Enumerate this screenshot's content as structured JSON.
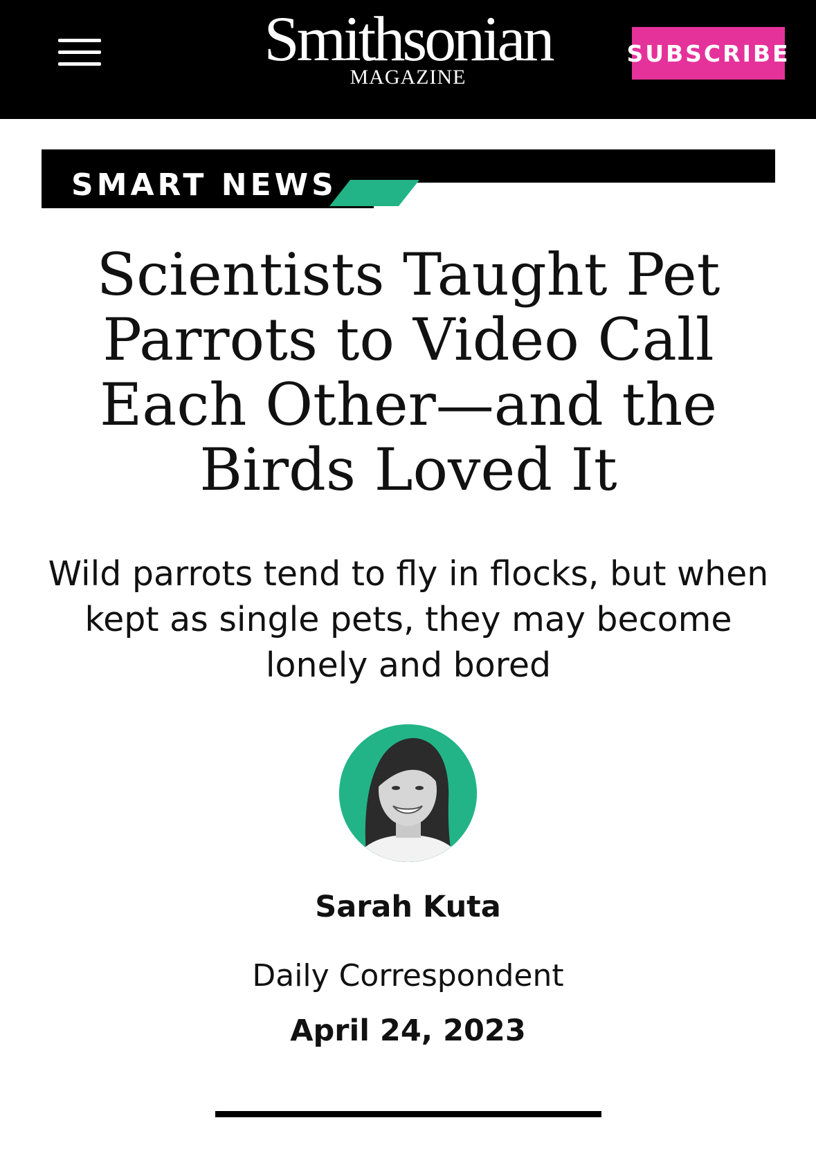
{
  "header": {
    "logo_main": "Smithsonian",
    "logo_sub": "MAGAZINE",
    "menu_icon": "hamburger-menu-icon",
    "subscribe_label": "SUBSCRIBE",
    "subscribe_color": "#e5329a",
    "background_color": "#000000"
  },
  "section": {
    "label": "SMART NEWS",
    "accent_color": "#22b486"
  },
  "article": {
    "headline": "Scientists Taught Pet Parrots to Video Call Each Other—and the Birds Loved It",
    "dek": "Wild parrots tend to fly in flocks, but when kept as single pets, they may become lonely and bored"
  },
  "author": {
    "name": "Sarah Kuta",
    "role": "Daily Correspondent",
    "avatar_background": "#22b486"
  },
  "date": "April 24, 2023"
}
